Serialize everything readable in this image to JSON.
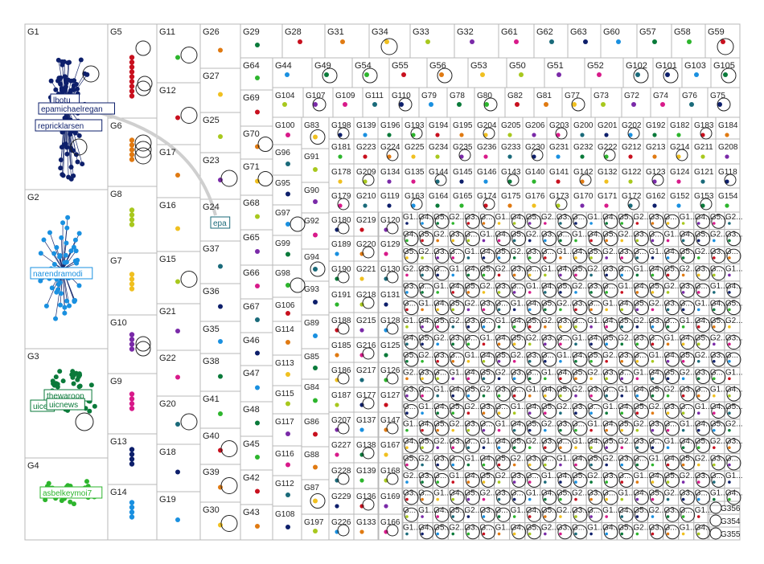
{
  "title": "",
  "colors": {
    "navy": "#0d1f6b",
    "blue": "#1a90e0",
    "green": "#0a7a3a",
    "lime": "#2db52d",
    "red": "#c8101e",
    "orange": "#e07a12",
    "yellow": "#f0c020",
    "olive": "#a8c81e",
    "purple": "#7a2aa8",
    "magenta": "#d81a8a",
    "teal": "#1a6a7a",
    "grid": "#b8b8b8"
  },
  "groups": {
    "col1": [
      "G1",
      "G2",
      "G3",
      "G4"
    ],
    "col2": [
      "G5",
      "G6",
      "G8",
      "G7",
      "G10",
      "G9",
      "G13",
      "G14"
    ],
    "col3": [
      "G11",
      "G12",
      "G17",
      "G16",
      "G15",
      "G21",
      "G22",
      "G20",
      "G18",
      "G19"
    ],
    "col4": [
      "G26",
      "G27",
      "G25",
      "G23",
      "G24",
      "G37",
      "G36",
      "G35",
      "G38",
      "G41",
      "G40",
      "G39",
      "G30"
    ],
    "col5": [
      "G29",
      "G64",
      "G69",
      "G70",
      "G71",
      "G68",
      "G65",
      "G66",
      "G67",
      "G46",
      "G47",
      "G48",
      "G45",
      "G42",
      "G43"
    ],
    "row_top": [
      "G28",
      "G31",
      "G34",
      "G33",
      "G32",
      "G61",
      "G62",
      "G63",
      "G60",
      "G57",
      "G58",
      "G59"
    ],
    "row2": [
      "G44",
      "G49",
      "G54",
      "G55",
      "G56",
      "G53",
      "G50",
      "G51",
      "G52",
      "G102",
      "G101",
      "G103",
      "G105"
    ],
    "row3": [
      "G104",
      "G107",
      "G109",
      "G111",
      "G110",
      "G79",
      "G78",
      "G80",
      "G82",
      "G81",
      "G77",
      "G73",
      "G72",
      "G74",
      "G76",
      "G75"
    ],
    "col6": [
      "G100",
      "G96",
      "G95",
      "G97",
      "G99",
      "G98",
      "G106",
      "G114",
      "G113",
      "G115",
      "G117",
      "G116",
      "G112",
      "G108"
    ],
    "col7": [
      "G83",
      "G91",
      "G90",
      "G92",
      "G94",
      "G93",
      "G89",
      "G85",
      "G84",
      "G86",
      "G88",
      "G87",
      "G197"
    ],
    "row4": [
      "G198",
      "G139",
      "G196",
      "G193",
      "G194",
      "G195",
      "G204",
      "G205",
      "G206",
      "G203",
      "G200",
      "G201",
      "G202",
      "G192",
      "G182",
      "G183",
      "G184"
    ],
    "row5": [
      "G181",
      "G223",
      "G224",
      "G225",
      "G234",
      "G235",
      "G236",
      "G233",
      "G230",
      "G231",
      "G232",
      "G222",
      "G212",
      "G213",
      "G214",
      "G211",
      "G208"
    ],
    "row6": [
      "G178",
      "G209",
      "G134",
      "G135",
      "G144",
      "G145",
      "G146",
      "G143",
      "G140",
      "G141",
      "G142",
      "G132",
      "G122",
      "G123",
      "G124",
      "G121",
      "G118"
    ],
    "row7": [
      "G179",
      "G210",
      "G119",
      "G163",
      "G164",
      "G165",
      "G174",
      "G175",
      "G176",
      "G173",
      "G170",
      "G171",
      "G172",
      "G162",
      "G152",
      "G153",
      "G154"
    ],
    "col8": [
      "G180",
      "G189",
      "G190",
      "G191",
      "G188",
      "G185",
      "G186",
      "G187",
      "G207",
      "G227",
      "G228",
      "G229",
      "G226"
    ],
    "col9": [
      "G219",
      "G220",
      "G221",
      "G218",
      "G215",
      "G216",
      "G217",
      "G177",
      "G137",
      "G138",
      "G139",
      "G136",
      "G133"
    ],
    "col10": [
      "G120",
      "G129",
      "G130",
      "G131",
      "G128",
      "G125",
      "G126",
      "G127",
      "G147",
      "G167",
      "G168",
      "G169",
      "G166"
    ],
    "corner": [
      "G356",
      "G354",
      "G355"
    ]
  },
  "vertex_labels": {
    "g1_a": "lbotu",
    "g1_b": "epamichaelregan",
    "g1_c": "repricklarsen",
    "g2_a": "narendramodi",
    "g3_a": "thewaroop",
    "g3_b": "uicnews",
    "g3_c": "uice",
    "g4_a": "asbelkeymoi7",
    "g24_a": "epa"
  },
  "dense_grid": {
    "label_prefixes": [
      "G1",
      "G4",
      "G5",
      "G2",
      "G3",
      "G"
    ],
    "truncated_label": "G..."
  }
}
